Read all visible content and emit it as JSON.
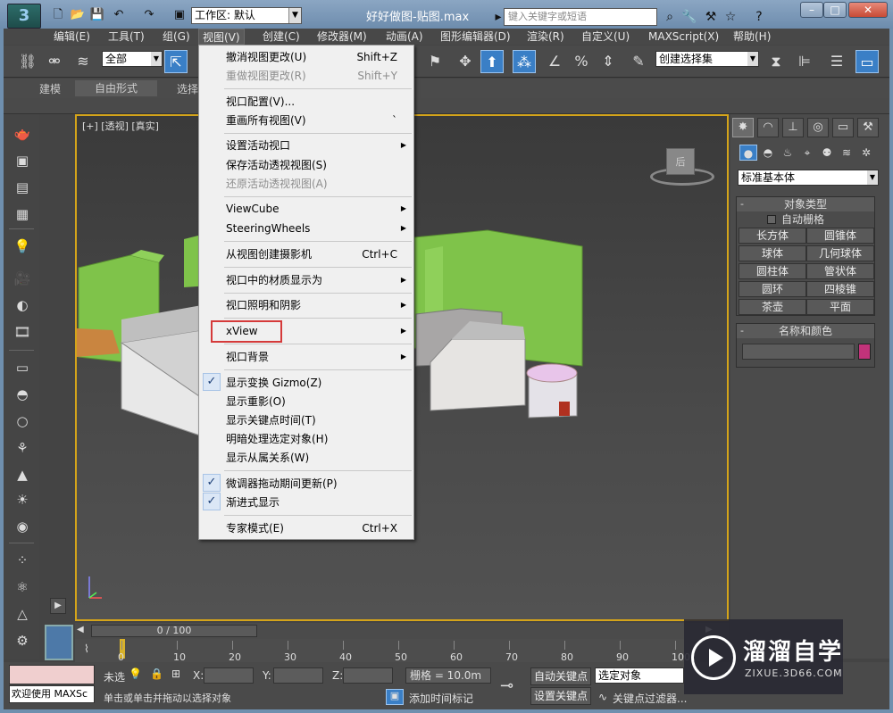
{
  "titlebar": {
    "logo": "3",
    "workspace_label": "工作区: 默认",
    "file_title": "好好做图-贴图.max",
    "search_placeholder": "键入关键字或短语"
  },
  "menubar": {
    "items": [
      "编辑(E)",
      "工具(T)",
      "组(G)",
      "视图(V)",
      "创建(C)",
      "修改器(M)",
      "动画(A)",
      "图形编辑器(D)",
      "渲染(R)",
      "自定义(U)",
      "MAXScript(X)",
      "帮助(H)"
    ],
    "active": "视图(V)"
  },
  "toolbar": {
    "selection_filter": "全部",
    "named_selection": "创建选择集"
  },
  "ribbon": {
    "tabs": [
      "建模",
      "自由形式",
      "选择"
    ]
  },
  "viewport": {
    "label": "[+] [透视] [真实]",
    "viewcube_face": "后"
  },
  "view_menu": {
    "items": [
      {
        "label": "撤消视图更改(U)",
        "shortcut": "Shift+Z",
        "disabled": false
      },
      {
        "label": "重做视图更改(R)",
        "shortcut": "Shift+Y",
        "disabled": true
      },
      {
        "label": "视口配置(V)...",
        "shortcut": "",
        "disabled": false
      },
      {
        "label": "重画所有视图(V)",
        "shortcut": "`",
        "disabled": false
      },
      {
        "label": "设置活动视口",
        "submenu": true
      },
      {
        "label": "保存活动透视视图(S)",
        "disabled": false
      },
      {
        "label": "还原活动透视视图(A)",
        "disabled": true
      },
      {
        "label": "ViewCube",
        "submenu": true
      },
      {
        "label": "SteeringWheels",
        "submenu": true
      },
      {
        "label": "从视图创建摄影机",
        "shortcut": "Ctrl+C"
      },
      {
        "label": "视口中的材质显示为",
        "submenu": true
      },
      {
        "label": "视口照明和阴影",
        "submenu": true
      },
      {
        "label": "xView",
        "submenu": true
      },
      {
        "label": "视口背景",
        "submenu": true
      },
      {
        "label": "显示变换 Gizmo(Z)",
        "checked": true
      },
      {
        "label": "显示重影(O)"
      },
      {
        "label": "显示关键点时间(T)"
      },
      {
        "label": "明暗处理选定对象(H)"
      },
      {
        "label": "显示从属关系(W)"
      },
      {
        "label": "微调器拖动期间更新(P)",
        "checked": true
      },
      {
        "label": "渐进式显示",
        "checked": true
      },
      {
        "label": "专家模式(E)",
        "shortcut": "Ctrl+X"
      }
    ],
    "highlighted": "xView"
  },
  "command_panel": {
    "category": "标准基本体",
    "object_type_title": "对象类型",
    "autogrid_label": "自动栅格",
    "buttons": [
      "长方体",
      "圆锥体",
      "球体",
      "几何球体",
      "圆柱体",
      "管状体",
      "圆环",
      "四棱锥",
      "茶壶",
      "平面"
    ],
    "name_color_title": "名称和颜色",
    "swatch_color": "#c2337a"
  },
  "timeline": {
    "frame_display": "0 / 100",
    "ticks": [
      "0",
      "10",
      "20",
      "30",
      "40",
      "50",
      "60",
      "70",
      "80",
      "90",
      "100"
    ]
  },
  "status": {
    "maxscript_label": "欢迎使用 MAXSc",
    "selected_text": "未选",
    "prompt_text": "单击或单击并拖动以选择对象",
    "x_label": "X:",
    "y_label": "Y:",
    "z_label": "Z:",
    "grid_label": "栅格 = 10.0m",
    "add_time_tag": "添加时间标记",
    "auto_key": "自动关键点",
    "set_key": "设置关键点",
    "selected_object": "选定对象",
    "key_filters": "关键点过滤器..."
  },
  "watermark": {
    "title": "溜溜自学",
    "url": "ZIXUE.3D66.COM"
  }
}
